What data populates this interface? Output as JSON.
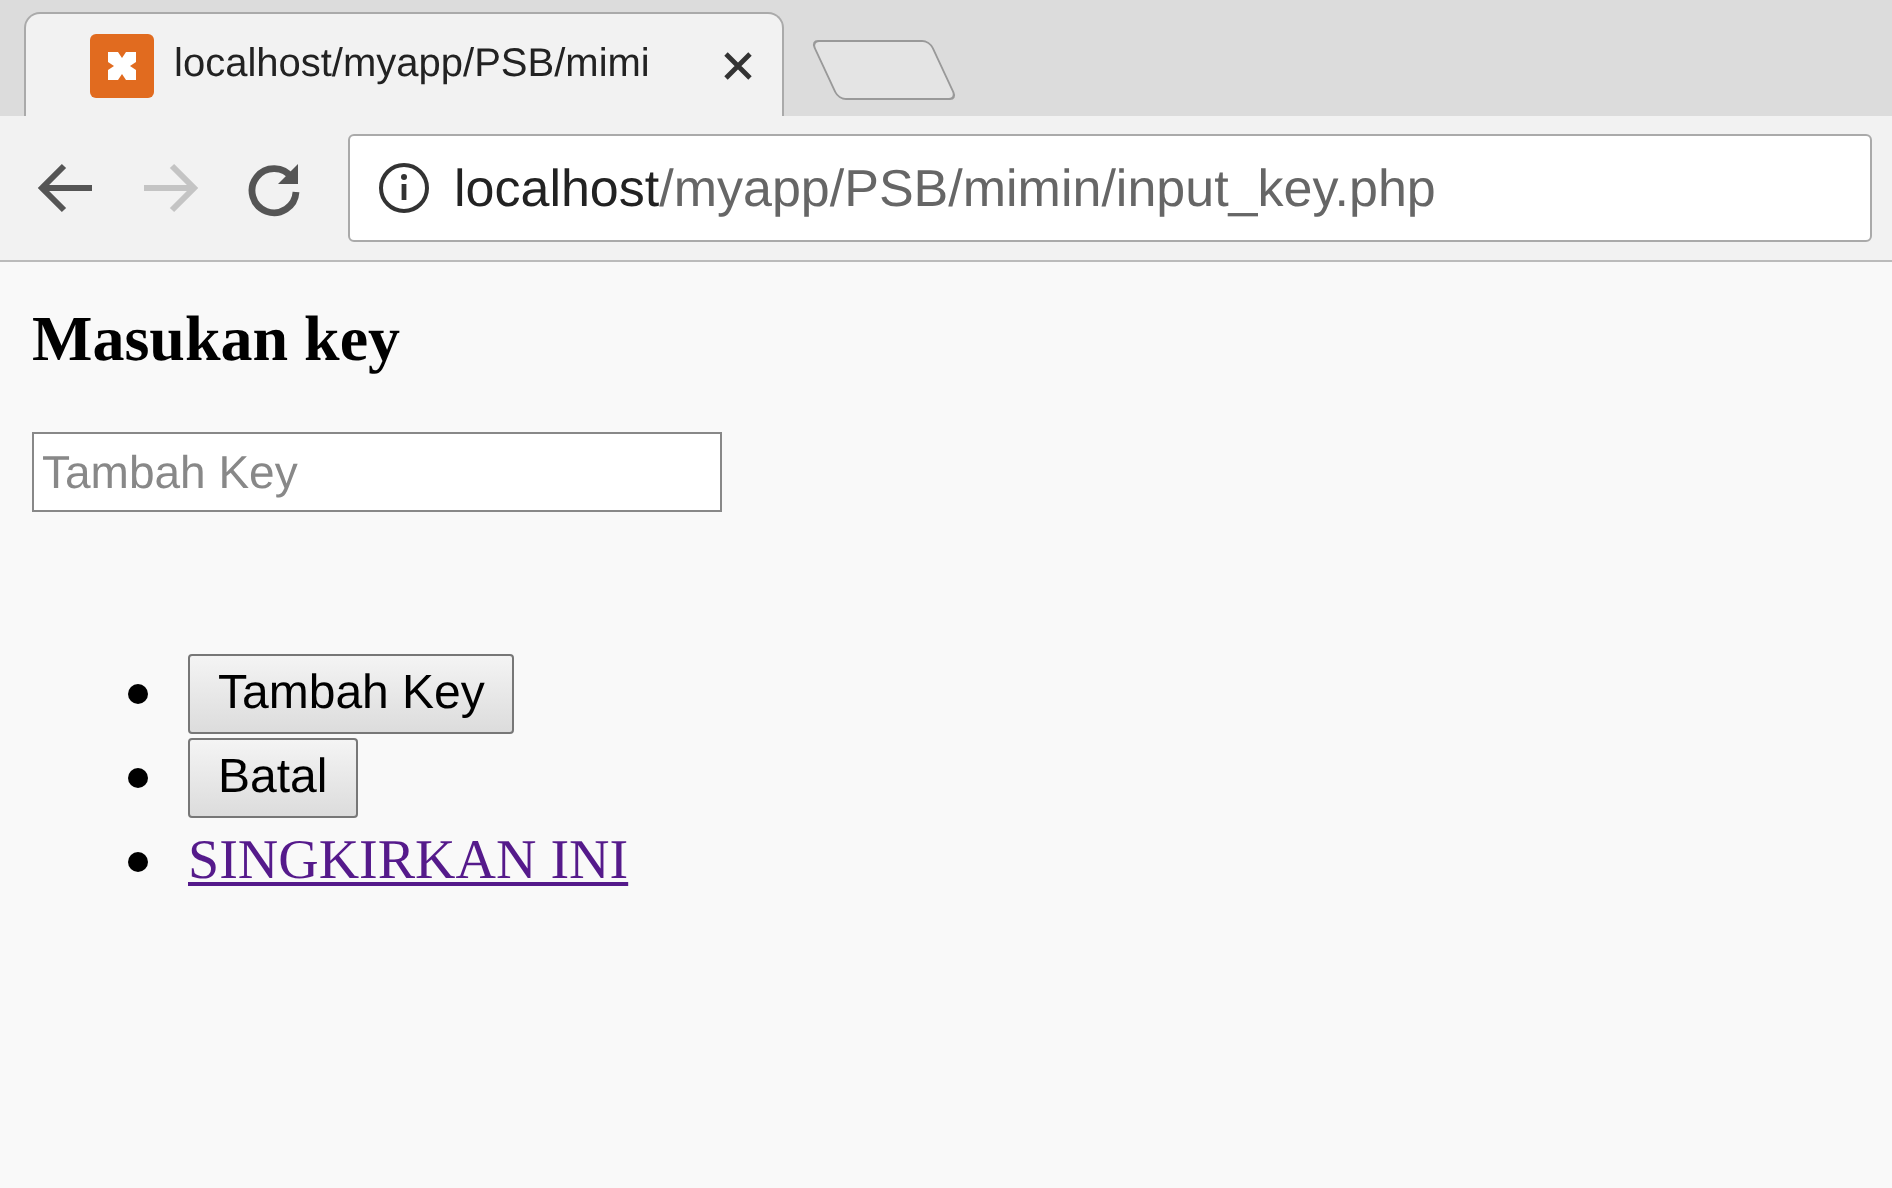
{
  "browser": {
    "tab": {
      "title": "localhost/myapp/PSB/mimi",
      "selected": true
    },
    "address": {
      "host": "localhost",
      "path": "/myapp/PSB/mimin/input_key.php"
    },
    "forward_disabled": true
  },
  "page": {
    "heading": "Masukan key",
    "input": {
      "placeholder": "Tambah Key"
    },
    "items": [
      {
        "kind": "button",
        "label": "Tambah Key"
      },
      {
        "kind": "button",
        "label": "Batal"
      },
      {
        "kind": "link",
        "label": "SINGKIRKAN INI"
      }
    ]
  }
}
